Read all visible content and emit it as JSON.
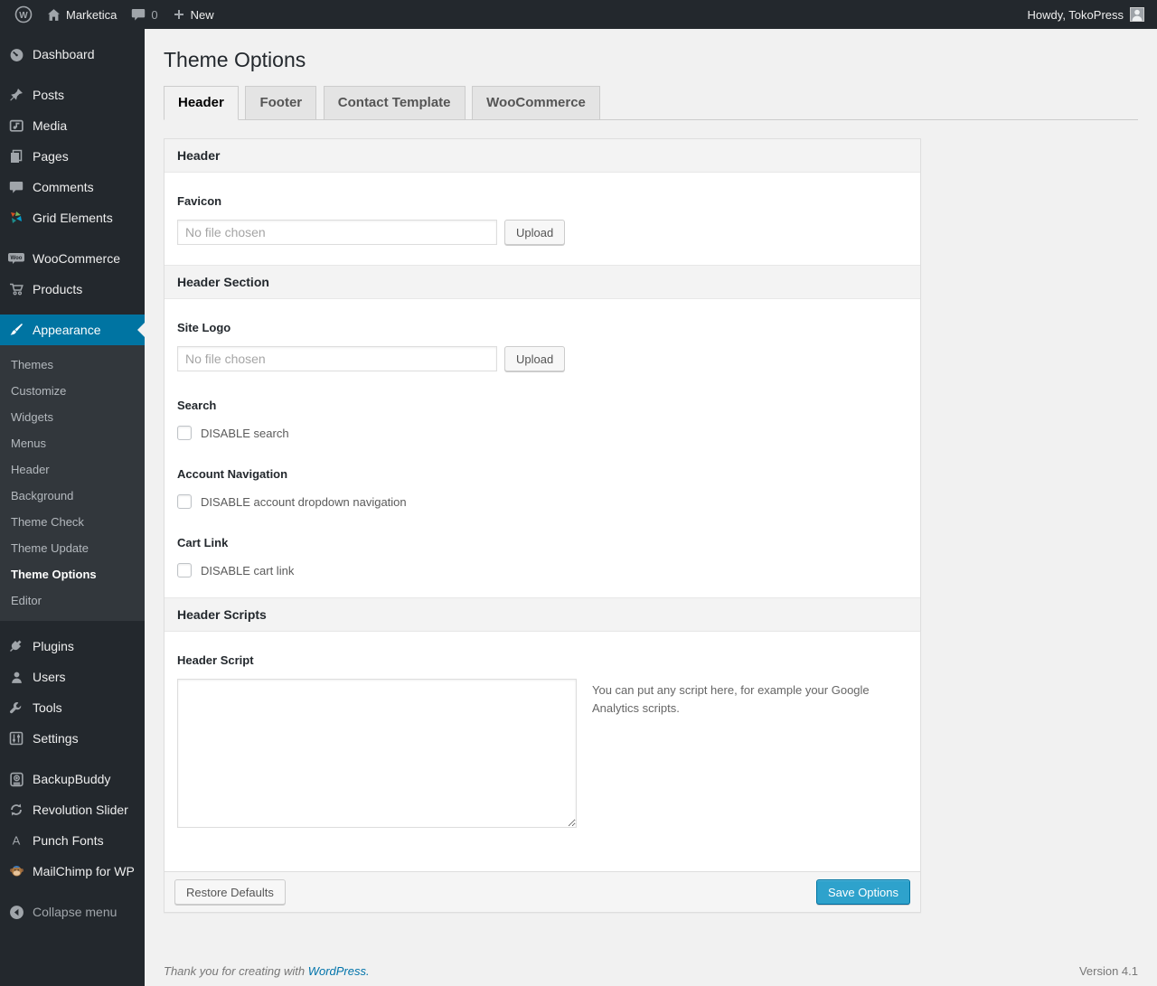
{
  "admin_bar": {
    "site_name": "Marketica",
    "comment_count": "0",
    "new_label": "New",
    "howdy": "Howdy, TokoPress"
  },
  "sidebar": {
    "dashboard": "Dashboard",
    "posts": "Posts",
    "media": "Media",
    "pages": "Pages",
    "comments": "Comments",
    "grid_elements": "Grid Elements",
    "woocommerce": "WooCommerce",
    "products": "Products",
    "appearance": "Appearance",
    "submenu": {
      "themes": "Themes",
      "customize": "Customize",
      "widgets": "Widgets",
      "menus": "Menus",
      "header": "Header",
      "background": "Background",
      "theme_check": "Theme Check",
      "theme_update": "Theme Update",
      "theme_options": "Theme Options",
      "editor": "Editor"
    },
    "plugins": "Plugins",
    "users": "Users",
    "tools": "Tools",
    "settings": "Settings",
    "backupbuddy": "BackupBuddy",
    "revolution_slider": "Revolution Slider",
    "punch_fonts": "Punch Fonts",
    "mailchimp": "MailChimp for WP",
    "collapse": "Collapse menu"
  },
  "page": {
    "title": "Theme Options",
    "tabs": {
      "header": "Header",
      "footer": "Footer",
      "contact": "Contact Template",
      "woocommerce": "WooCommerce"
    }
  },
  "panel": {
    "section_header": "Header",
    "favicon_label": "Favicon",
    "favicon_placeholder": "No file chosen",
    "upload_label": "Upload",
    "section_header_section": "Header Section",
    "site_logo_label": "Site Logo",
    "site_logo_placeholder": "No file chosen",
    "search_label": "Search",
    "search_checkbox": "DISABLE search",
    "account_nav_label": "Account Navigation",
    "account_nav_checkbox": "DISABLE account dropdown navigation",
    "cart_link_label": "Cart Link",
    "cart_link_checkbox": "DISABLE cart link",
    "section_scripts": "Header Scripts",
    "header_script_label": "Header Script",
    "header_script_help": "You can put any script here, for example your Google Analytics scripts.",
    "restore_defaults_label": "Restore Defaults",
    "save_options_label": "Save Options"
  },
  "footer": {
    "thanks_prefix": "Thank you for creating with ",
    "wordpress_link": "WordPress.",
    "version": "Version 4.1"
  },
  "colors": {
    "admin_bar_bg": "#23282d",
    "sidebar_bg": "#23282d",
    "submenu_bg": "#32373c",
    "menu_highlight": "#0074a2",
    "primary_button": "#2ea2cc",
    "page_bg": "#f1f1f1",
    "link": "#0073aa"
  }
}
